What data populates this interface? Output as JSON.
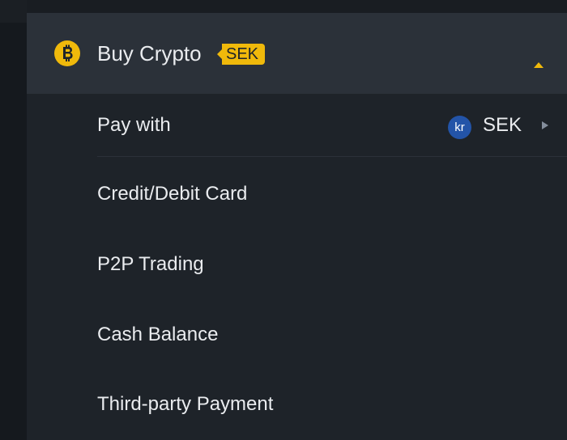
{
  "header": {
    "title": "Buy Crypto",
    "currency_tag": "SEK",
    "coin_icon": "bitcoin-icon",
    "expand_icon": "caret-up-icon"
  },
  "pay_with": {
    "label": "Pay with",
    "currency_symbol": "kr",
    "currency_code": "SEK",
    "arrow_icon": "chevron-right-icon"
  },
  "options": [
    {
      "label": "Credit/Debit Card"
    },
    {
      "label": "P2P Trading"
    },
    {
      "label": "Cash Balance"
    },
    {
      "label": "Third-party Payment"
    }
  ],
  "colors": {
    "background": "#1e2329",
    "header_background": "#2b3139",
    "accent": "#f0b90b",
    "text": "#eaecef",
    "currency_badge": "#2354a8",
    "muted_icon": "#848e9c"
  }
}
